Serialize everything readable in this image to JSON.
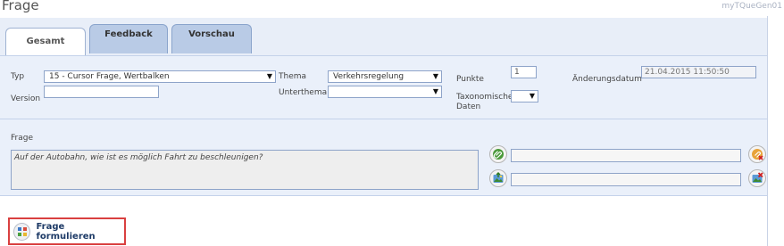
{
  "page": {
    "title": "Frage",
    "app_id": "myTQueGen01"
  },
  "tabs": [
    {
      "label": "Gesamt",
      "active": true
    },
    {
      "label": "Feedback",
      "active": false
    },
    {
      "label": "Vorschau",
      "active": false
    }
  ],
  "form": {
    "typ_label": "Typ",
    "typ_value": "15 - Cursor Frage, Wertbalken",
    "version_label": "Version",
    "version_value": "",
    "thema_label": "Thema",
    "thema_value": "Verkehrsregelung",
    "unterthema_label": "Unterthema",
    "unterthema_value": "",
    "punkte_label": "Punkte",
    "punkte_value": "1",
    "taxonomische_label_1": "Taxonomische",
    "taxonomische_label_2": "Daten",
    "taxonomische_value": "",
    "aenderungsdatum_label": "Änderungsdatum",
    "aenderungsdatum_value": "21.04.2015 11:50:50"
  },
  "frage": {
    "label": "Frage",
    "text": "Auf der Autobahn, wie ist es möglich Fahrt zu beschleunigen?"
  },
  "attachments": {
    "link_field_value": "",
    "image_field_value": ""
  },
  "icons": {
    "attach_link": "paperclip-icon",
    "attach_image": "image-upload-icon",
    "remove_link": "remove-link-icon",
    "remove_image": "remove-image-icon",
    "formulate": "wizard-icon",
    "dropdown": "chevron-down-icon"
  },
  "colors": {
    "accent_blue": "#1d3a66",
    "tab_inactive": "#b9cbe6",
    "form_bg": "#eaf0fa",
    "highlight_border": "#d94040"
  },
  "footer": {
    "button_label": "Frage formulieren"
  }
}
